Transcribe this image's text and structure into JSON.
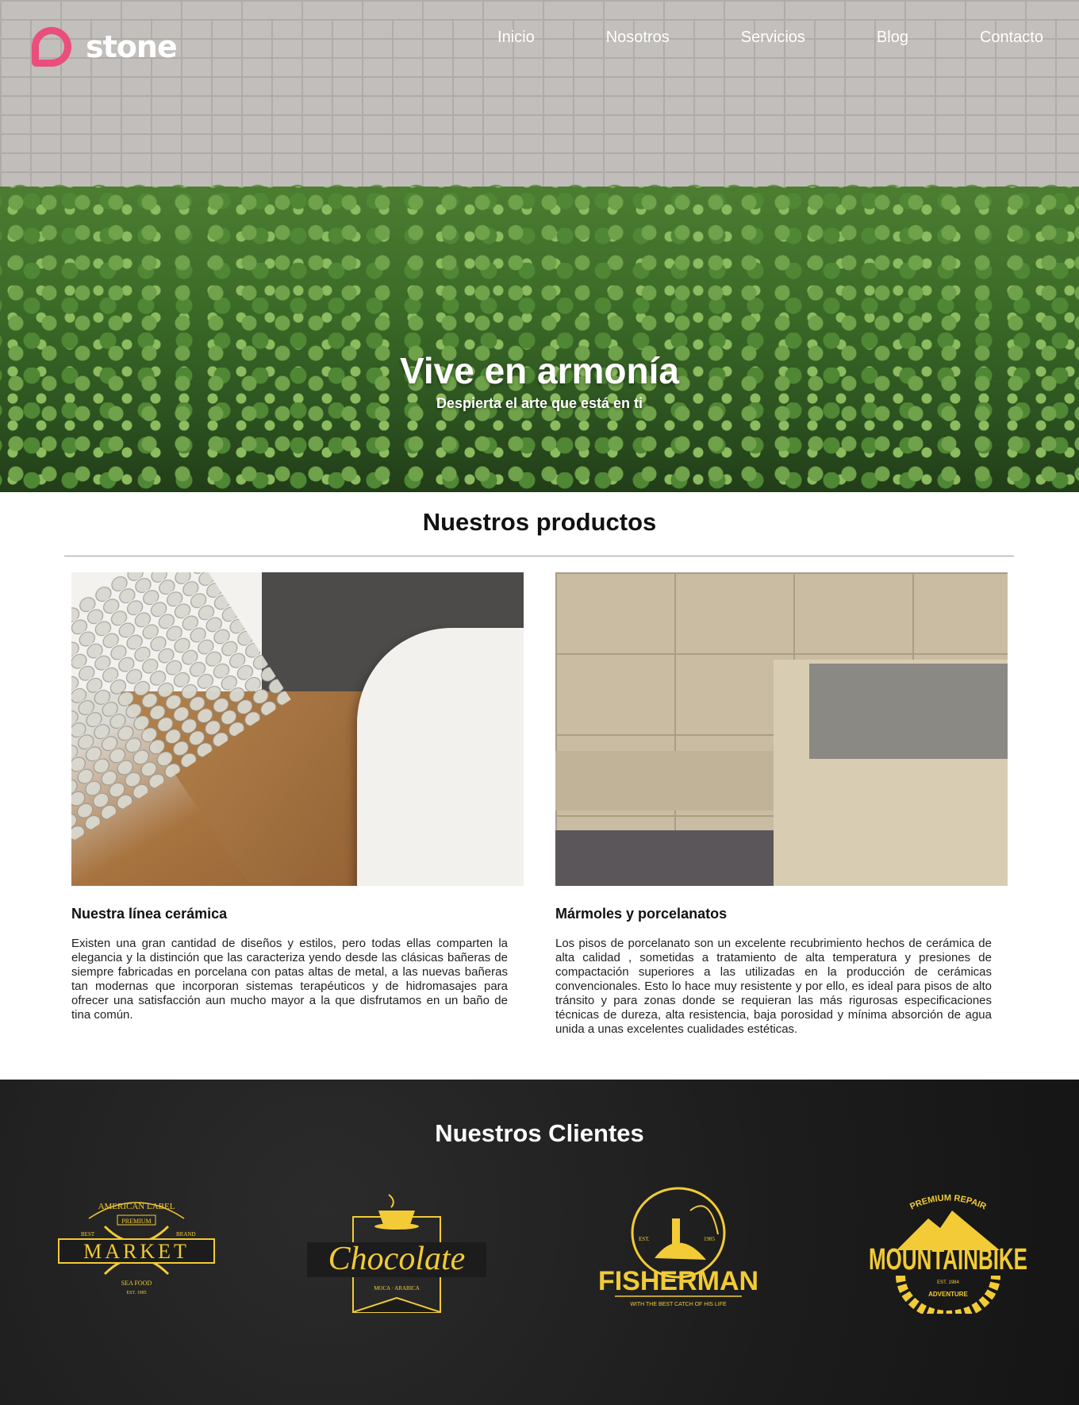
{
  "header": {
    "logo_text": "stone",
    "brand_color": "#ea4e7a",
    "nav": [
      {
        "label": "Inicio"
      },
      {
        "label": "Nosotros"
      },
      {
        "label": "Servicios"
      },
      {
        "label": "Blog"
      },
      {
        "label": "Contacto"
      }
    ]
  },
  "hero": {
    "title": "Vive en armonía",
    "subtitle": "Despierta el arte que está en ti"
  },
  "products": {
    "title": "Nuestros productos",
    "items": [
      {
        "title": "Nuestra línea cerámica",
        "text": "Existen una gran cantidad de diseños y estilos, pero todas ellas comparten la elegancia y la distinción que las caracteriza yendo desde las clásicas bañeras de siempre fabricadas en porcelana con patas altas de metal, a las nuevas bañeras tan modernas que incorporan sistemas terapéuticos y de hidromasajes para ofrecer una satisfacción aun mucho mayor a la que disfrutamos en un baño de tina común."
      },
      {
        "title": "Mármoles y porcelanatos",
        "text": "Los pisos de porcelanato son un excelente recubrimiento hechos de cerámica de alta calidad , sometidas a tratamiento de alta temperatura y presiones de compactación superiores a las utilizadas en la producción de cerámicas convencionales. Esto lo hace muy resistente y por ello, es ideal para pisos de alto tránsito y para zonas donde se requieran las más rigurosas especificaciones técnicas de dureza, alta resistencia, baja porosidad y mínima absorción de agua unida a unas excelentes cualidades estéticas."
      }
    ]
  },
  "clients": {
    "title": "Nuestros Clientes",
    "accent_color": "#f2cb36",
    "logos": [
      {
        "name": "MARKET",
        "top": "AMERICAN LABEL",
        "badge": "PREMIUM",
        "left_small": "BEST",
        "right_small": "BRAND",
        "bottom": "SEA FOOD",
        "est": "EST. 1985"
      },
      {
        "name": "Chocolate",
        "bottom": "MOCA · ARABICA"
      },
      {
        "name": "FISHERMAN",
        "est_left": "EST.",
        "est_right": "1985",
        "bottom": "WITH THE BEST CATCH OF HIS LIFE"
      },
      {
        "name": "MOUNTAINBIKE",
        "top": "PREMIUM REPAIR",
        "est": "EST. 1984",
        "bottom": "ADVENTURE"
      }
    ]
  }
}
